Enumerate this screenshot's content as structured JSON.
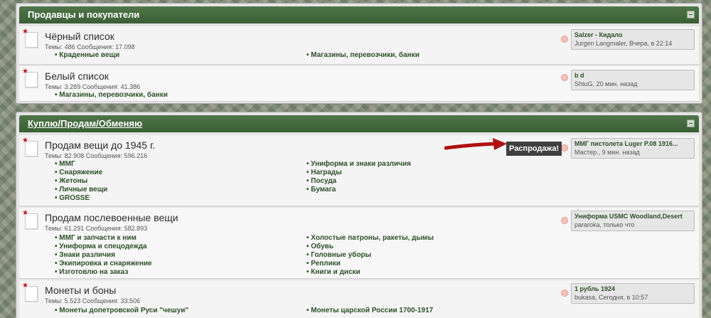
{
  "sections": [
    {
      "title": "Продавцы и покупатели",
      "forums": [
        {
          "title": "Чёрный список",
          "stats_label_topics": "Темы:",
          "topics": "486",
          "stats_label_posts": "Сообщения:",
          "posts": "17.098",
          "subforums_left": [
            "Краденные вещи"
          ],
          "subforums_right": [
            "Магазины, перевозчики, банки"
          ],
          "last_post": {
            "title": "Salzer - Кидало",
            "meta": "Jurgen Langmaler, Вчера, в 22:14"
          }
        },
        {
          "title": "Белый список",
          "stats_label_topics": "Темы:",
          "topics": "3.289",
          "stats_label_posts": "Сообщения:",
          "posts": "41.386",
          "subforums_left": [
            "Магазины, перевозчики, банки"
          ],
          "subforums_right": [],
          "last_post": {
            "title": "b d",
            "meta": "ShtuG, 20 мин. назад"
          }
        }
      ]
    },
    {
      "title": "Куплю/Продам/Обменяю",
      "forums": [
        {
          "title": "Продам вещи до 1945 г.",
          "stats_label_topics": "Темы:",
          "topics": "82.908",
          "stats_label_posts": "Сообщения:",
          "posts": "596.216",
          "subforums_left": [
            "ММГ",
            "Снаряжение",
            "Жетоны",
            "Личные вещи",
            "GROSSE"
          ],
          "subforums_right": [
            "Униформа и знаки различия",
            "Награды",
            "Посуда",
            "Бумага"
          ],
          "last_post": {
            "title": "ММГ пистолета Luger P.08 1916...",
            "meta": "Мастер., 9 мин. назад"
          }
        },
        {
          "title": "Продам послевоенные вещи",
          "stats_label_topics": "Темы:",
          "topics": "61.291",
          "stats_label_posts": "Сообщения:",
          "posts": "582.893",
          "subforums_left": [
            "ММГ и запчасти к ним",
            "Униформа и спецодежда",
            "Знаки различия",
            "Экипировка и снаряжение",
            "Изготовлю на заказ"
          ],
          "subforums_right": [
            "Холостые патроны, ракеты, дымы",
            "Обувь",
            "Головные уборы",
            "Реплики",
            "Книги и диски"
          ],
          "last_post": {
            "title": "Униформа USMC Woodland,Desert",
            "meta": "pararoka, только что"
          }
        },
        {
          "title": "Монеты и боны",
          "stats_label_topics": "Темы:",
          "topics": "5.523",
          "stats_label_posts": "Сообщения:",
          "posts": "33.506",
          "subforums_left": [
            "Монеты допетровской Руси \"чешуи\""
          ],
          "subforums_right": [
            "Монеты царской России 1700-1917"
          ],
          "last_post": {
            "title": "1 рубль 1924",
            "meta": "bukasa, Сегодня, в 10:57"
          }
        }
      ]
    }
  ],
  "annotation": {
    "label": "Распродажа!",
    "arrow_color": "#b01010"
  }
}
